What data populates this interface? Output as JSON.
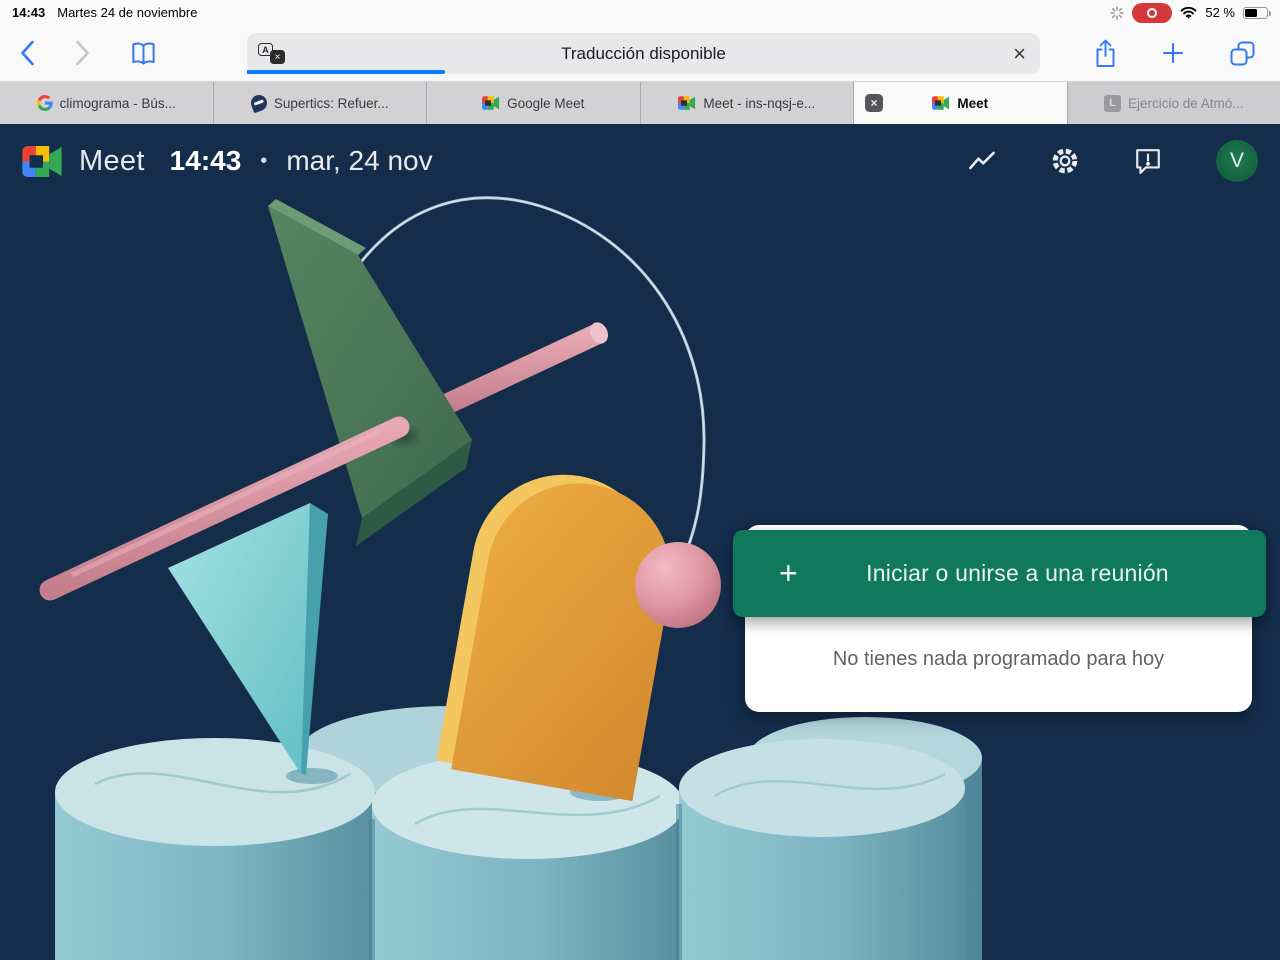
{
  "status_bar": {
    "time": "14:43",
    "date": "Martes 24 de noviembre",
    "battery_percent": "52 %"
  },
  "toolbar": {
    "address_text": "Traducción disponible",
    "icons": {
      "back": "back-chevron-icon",
      "forward": "forward-chevron-icon",
      "bookmarks": "bookmarks-book-icon",
      "translate_a": "A",
      "translate_b": "×",
      "close": "×",
      "share": "share-icon",
      "new_tab": "plus-icon",
      "tabs": "tabs-overview-icon"
    }
  },
  "tab_bar": {
    "tabs": [
      {
        "label": "climograma - Bús...",
        "icon": "google-favicon"
      },
      {
        "label": "Supertics: Refuer...",
        "icon": "supertics-favicon"
      },
      {
        "label": "Google Meet",
        "icon": "meet-favicon"
      },
      {
        "label": "Meet - ins-nqsj-e...",
        "icon": "meet-favicon"
      },
      {
        "label": "Meet",
        "icon": "meet-favicon",
        "active": true,
        "close_glyph": "×"
      },
      {
        "label": "Ejercicio de Atmó...",
        "icon": "letter-l-favicon",
        "letter": "L"
      }
    ]
  },
  "meet": {
    "header": {
      "app_name": "Meet",
      "time": "14:43",
      "separator": "•",
      "date": "mar, 24 nov",
      "icons": [
        "trending-icon",
        "settings-gear-icon",
        "feedback-icon"
      ],
      "avatar_letter": "V"
    },
    "card": {
      "plus_glyph": "+",
      "button_label": "Iniciar o unirse a una reunión",
      "empty_text": "No tienes nada programado para hoy"
    }
  },
  "colors": {
    "page_navy": "#132d4b",
    "accent_green": "#10795c",
    "progress_blue": "#0a7cff",
    "record_red": "#d6383e",
    "avatar_green": "#1d7a50"
  }
}
